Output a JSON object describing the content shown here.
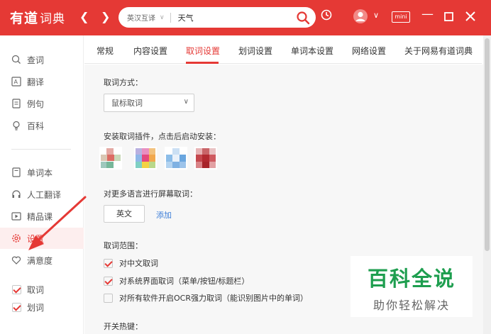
{
  "app": {
    "logo_main": "有道",
    "logo_sub": "词典",
    "mini_label": "mini"
  },
  "search": {
    "lang": "英汉互译",
    "query": "天气"
  },
  "sidebar": {
    "items": [
      {
        "label": "查词",
        "icon": "search-icon"
      },
      {
        "label": "翻译",
        "icon": "translate-icon"
      },
      {
        "label": "例句",
        "icon": "document-icon"
      },
      {
        "label": "百科",
        "icon": "bulb-icon"
      },
      {
        "label": "单词本",
        "icon": "wordbook-icon"
      },
      {
        "label": "人工翻译",
        "icon": "headset-icon"
      },
      {
        "label": "精品课",
        "icon": "play-icon"
      },
      {
        "label": "设置",
        "icon": "gear-icon"
      },
      {
        "label": "满意度",
        "icon": "heart-icon"
      }
    ],
    "checks": [
      {
        "label": "取词",
        "checked": true
      },
      {
        "label": "划词",
        "checked": true
      }
    ]
  },
  "tabs": [
    "常规",
    "内容设置",
    "取词设置",
    "划词设置",
    "单词本设置",
    "网络设置",
    "关于网易有道词典"
  ],
  "active_tab": "取词设置",
  "main": {
    "capture_mode_label": "取词方式：",
    "capture_mode_value": "鼠标取词",
    "plugins_label": "安装取词插件，点击后启动安装：",
    "multi_lang_label": "对更多语言进行屏幕取词：",
    "english_button": "英文",
    "add_link": "添加",
    "scope_label": "取词范围：",
    "options": [
      {
        "label": "对中文取词",
        "checked": true
      },
      {
        "label": "对系统界面取词（菜单/按钮/标题栏）",
        "checked": true
      },
      {
        "label": "对所有软件开启OCR强力取词（能识别图片中的单词）",
        "checked": false
      }
    ],
    "hotkey_label": "开关热键："
  },
  "watermark": {
    "big": "百科全说",
    "small": "助你轻松解决"
  },
  "colors": {
    "brand": "#e53935",
    "link": "#3b7dd8",
    "watermark": "#1e9e4f"
  }
}
